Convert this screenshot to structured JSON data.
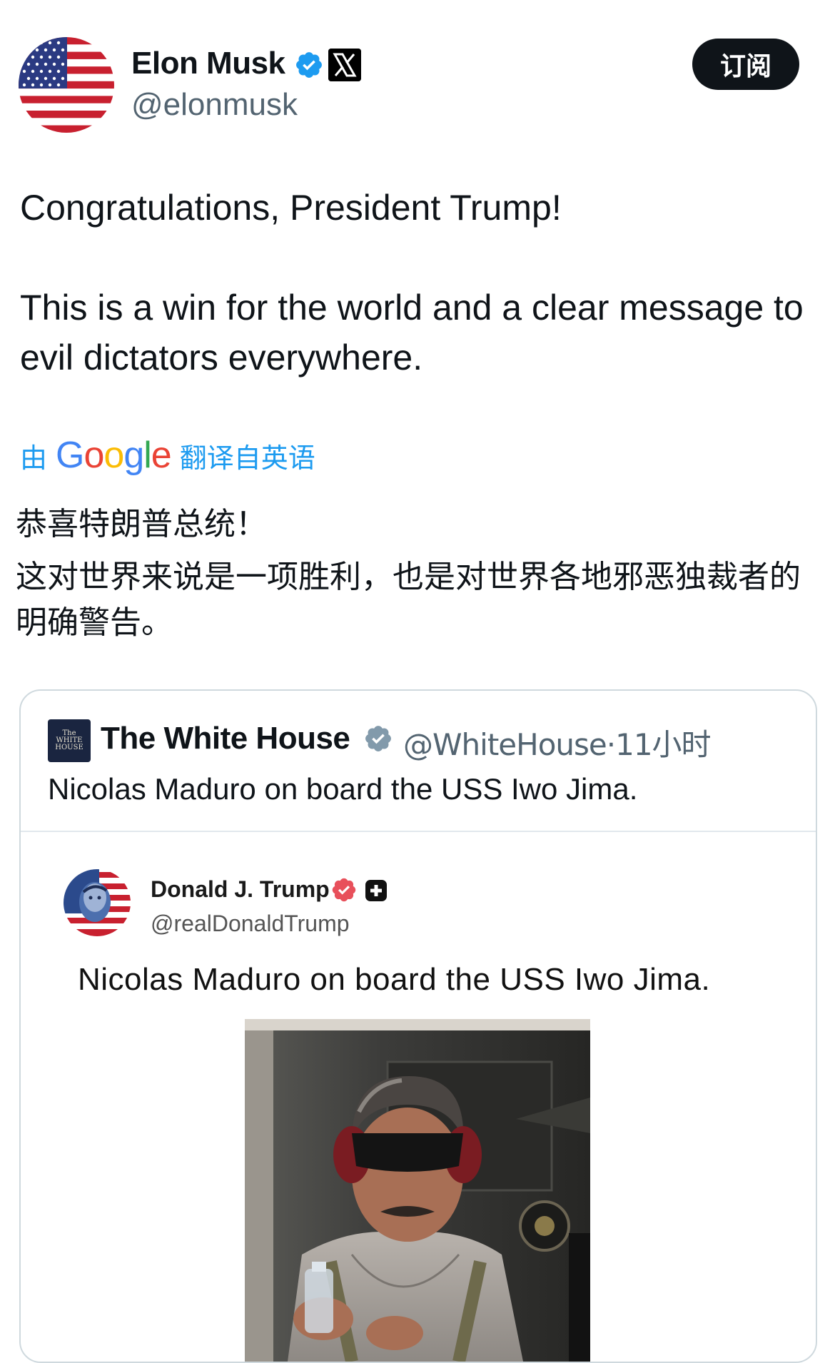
{
  "header": {
    "author_name": "Elon Musk",
    "author_handle": "@elonmusk",
    "subscribe_label": "订阅"
  },
  "tweet": {
    "paragraphs": [
      "Congratulations, President Trump!",
      "This is a win for the world and a clear message to evil dictators everywhere."
    ]
  },
  "translation": {
    "prefix": "由",
    "provider": "Google",
    "suffix": "翻译自英语",
    "lines": [
      "恭喜特朗普总统！",
      "这对世界来说是一项胜利，也是对世界各地邪恶独裁者的明确警告。"
    ]
  },
  "quote": {
    "avatar_lines": [
      "The",
      "WHITE",
      "HOUSE"
    ],
    "name": "The White House",
    "handle": "@WhiteHouse",
    "separator": "·",
    "time": "11小时",
    "text": "Nicolas Maduro on board the USS Iwo Jima.",
    "embedded": {
      "name": "Donald J. Trump",
      "handle": "@realDonaldTrump",
      "text": "Nicolas Maduro on board the USS Iwo Jima."
    }
  },
  "colors": {
    "accent": "#1d9bf0",
    "text": "#0f1419",
    "muted": "#536471",
    "truth_badge": "#e8505b"
  }
}
